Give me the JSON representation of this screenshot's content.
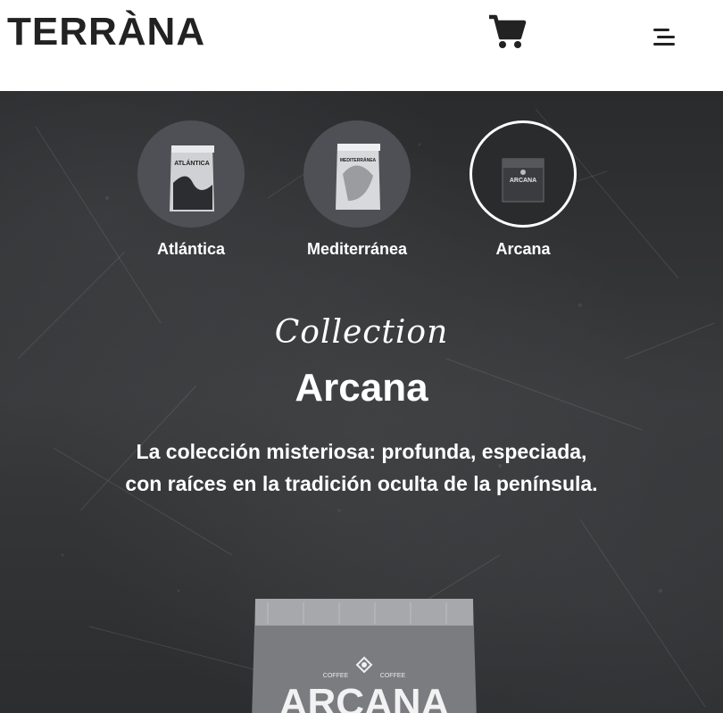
{
  "header": {
    "logo_text": "TERRÀNA",
    "cart_icon": "shopping-cart-icon",
    "menu_icon": "hamburger-menu-icon"
  },
  "collections": [
    {
      "label": "Atlántica",
      "active": false,
      "pack_text": "ATLÁNTICA"
    },
    {
      "label": "Mediterránea",
      "active": false,
      "pack_text": "MEDITERRÁNEA"
    },
    {
      "label": "Arcana",
      "active": true,
      "pack_text": "ARCANA"
    }
  ],
  "hero": {
    "script_text": "Collection",
    "title": "Arcana",
    "description_line1": "La colección misteriosa: profunda, especiada,",
    "description_line2": "con raíces en la tradición oculta de la península."
  },
  "product": {
    "brand": "ARCANA",
    "small_left": "COFFEE",
    "small_right": "COFFEE"
  },
  "colors": {
    "header_bg": "#ffffff",
    "hero_bg": "#2e2f31",
    "text": "#ffffff",
    "logo": "#222222"
  }
}
